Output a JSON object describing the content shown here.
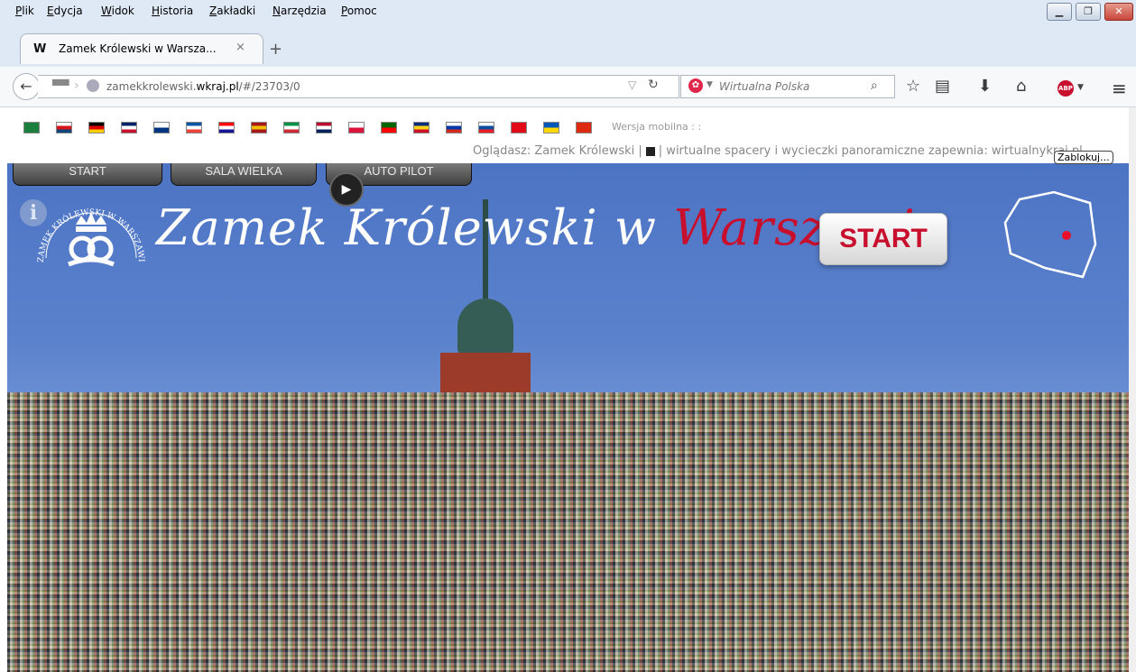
{
  "menubar": {
    "items": [
      "Plik",
      "Edycja",
      "Widok",
      "Historia",
      "Zakładki",
      "Narzędzia",
      "Pomoc"
    ]
  },
  "tab": {
    "title": "Zamek Królewski w Warsza...",
    "close": "×",
    "new_tab": "+"
  },
  "navbar": {
    "url_host_prefix": "zamekkrolewski.",
    "url_host_domain": "wkraj.pl",
    "url_path": "/#/23703/0",
    "search_placeholder": "Wirtualna Polska",
    "search_engine_icon": "wp-icon"
  },
  "content": {
    "flags": [
      {
        "name": "flag-saudi-arabia",
        "colors": [
          "#1a7f3c",
          "#1a7f3c"
        ]
      },
      {
        "name": "flag-czech",
        "colors": [
          "#ffffff",
          "#d7141a",
          "#11457e"
        ]
      },
      {
        "name": "flag-germany",
        "colors": [
          "#000000",
          "#dd0000",
          "#ffce00"
        ]
      },
      {
        "name": "flag-uk",
        "colors": [
          "#012169",
          "#ffffff",
          "#c8102e"
        ]
      },
      {
        "name": "flag-finland",
        "colors": [
          "#ffffff",
          "#003580"
        ]
      },
      {
        "name": "flag-france",
        "colors": [
          "#0055a4",
          "#ffffff",
          "#ef4135"
        ]
      },
      {
        "name": "flag-croatia",
        "colors": [
          "#ff0000",
          "#ffffff",
          "#171796"
        ]
      },
      {
        "name": "flag-spain",
        "colors": [
          "#aa151b",
          "#f1bf00",
          "#aa151b"
        ]
      },
      {
        "name": "flag-italy",
        "colors": [
          "#009246",
          "#ffffff",
          "#ce2b37"
        ]
      },
      {
        "name": "flag-norway",
        "colors": [
          "#ba0c2f",
          "#ffffff",
          "#00205b"
        ]
      },
      {
        "name": "flag-poland",
        "colors": [
          "#ffffff",
          "#dc143c"
        ]
      },
      {
        "name": "flag-portugal",
        "colors": [
          "#006600",
          "#ff0000"
        ]
      },
      {
        "name": "flag-romania",
        "colors": [
          "#002b7f",
          "#fcd116",
          "#ce1126"
        ]
      },
      {
        "name": "flag-russia",
        "colors": [
          "#ffffff",
          "#0039a6",
          "#d52b1e"
        ]
      },
      {
        "name": "flag-slovakia",
        "colors": [
          "#ffffff",
          "#0b4ea2",
          "#ee1c25"
        ]
      },
      {
        "name": "flag-turkey",
        "colors": [
          "#e30a17",
          "#e30a17"
        ]
      },
      {
        "name": "flag-ukraine",
        "colors": [
          "#0057b7",
          "#ffd700"
        ]
      },
      {
        "name": "flag-china",
        "colors": [
          "#de2910",
          "#de2910"
        ]
      }
    ],
    "mobile_label": "Wersja mobilna :  :",
    "viewing_prefix": "Oglądasz: Zamek Królewski |",
    "viewing_suffix": "|  wirtualne spacery i wycieczki panoramiczne zapewnia: wirtualnykraj.pl",
    "blocked_button": "Zablokuj...",
    "nav_tabs": [
      "START",
      "SALA WIELKA",
      "AUTO PILOT"
    ],
    "logo_text_white": "Zamek Królewski w ",
    "logo_text_red": "Warszawie",
    "emblem_text": "ZAMEK KRÓLEWSKI W WARSZAWIE",
    "start_button": "START",
    "map_dot_color": "#e8102a"
  }
}
